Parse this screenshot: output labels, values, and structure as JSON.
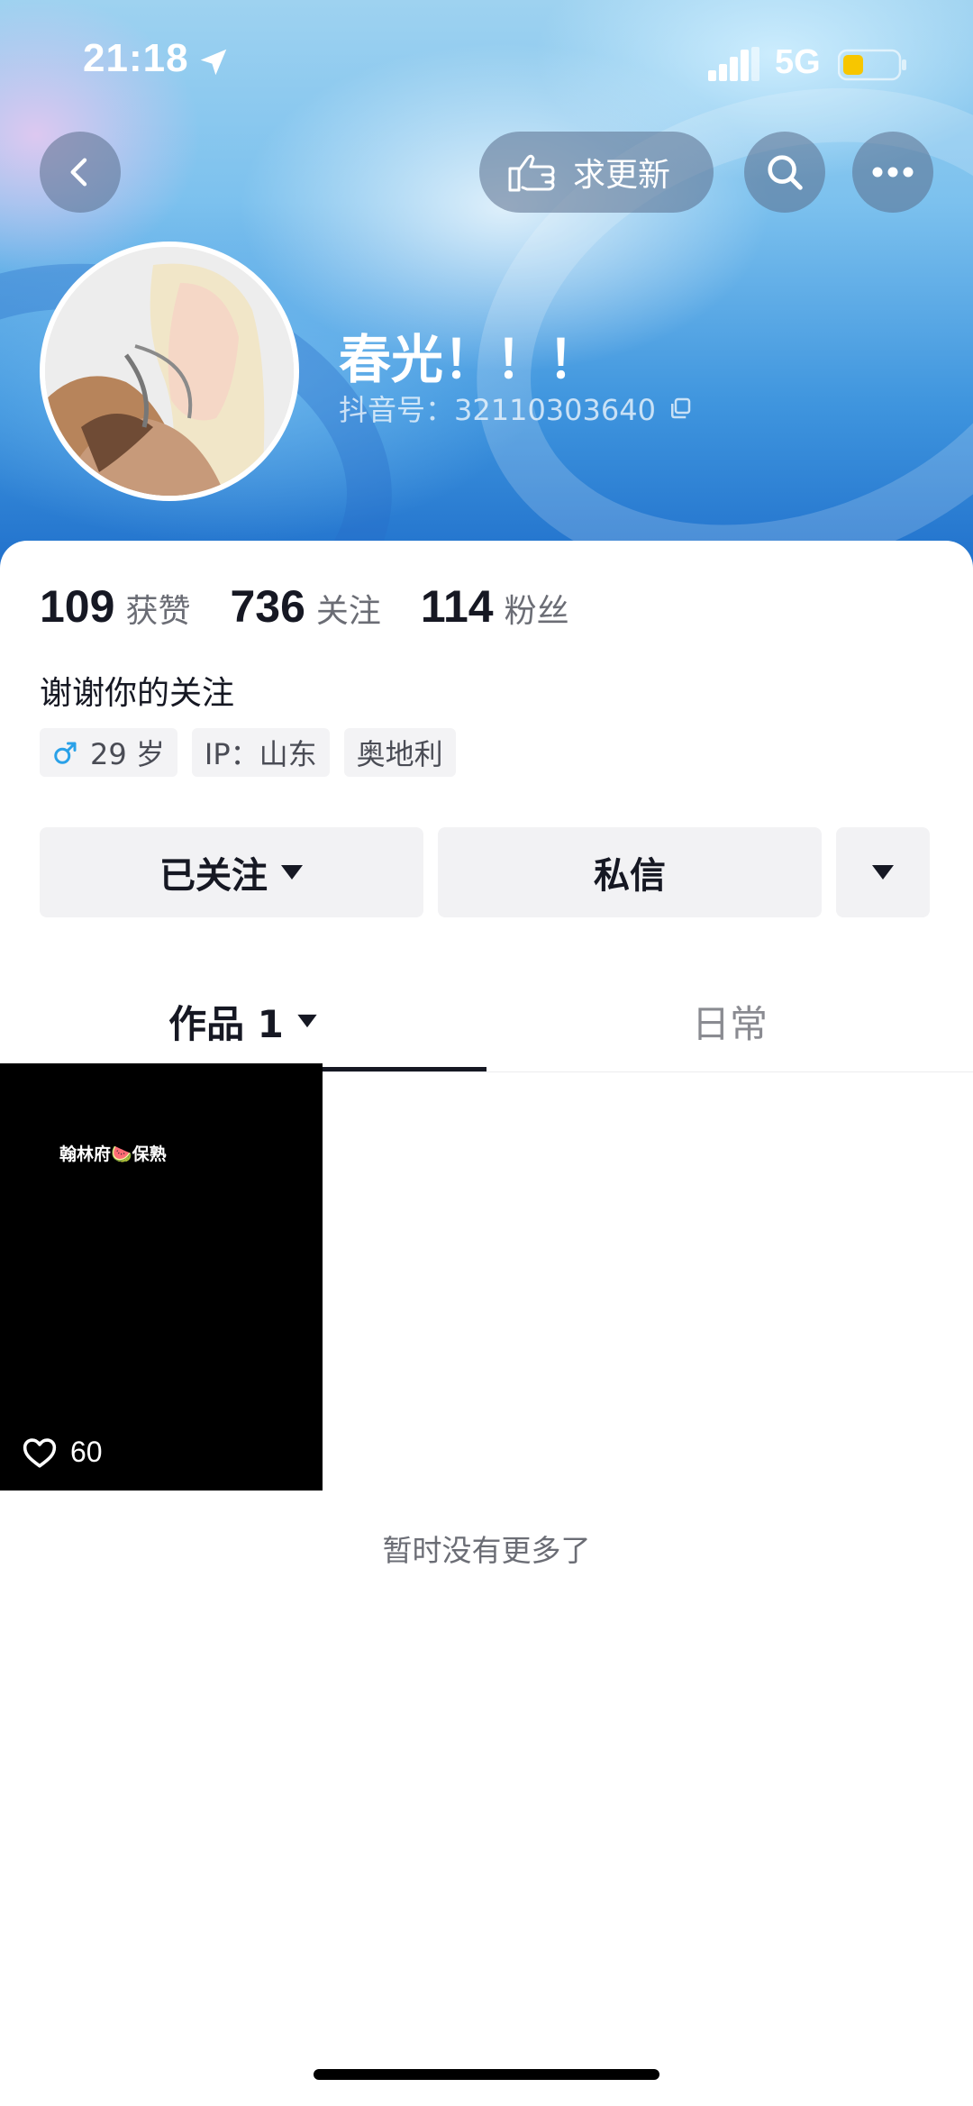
{
  "status_bar": {
    "time": "21:18",
    "network": "5G",
    "icons": [
      "location-arrow-icon",
      "signal-icon",
      "battery-icon"
    ],
    "battery_color": "#f7c600"
  },
  "toolbar": {
    "back_icon": "chevron-left-icon",
    "update_label": "求更新",
    "update_icon": "pointing-hand-icon",
    "search_icon": "search-icon",
    "more_icon": "more-dots-icon"
  },
  "profile": {
    "name": "春光！！！",
    "id_label": "抖音号：32110303640",
    "avatar": "avatar-photo"
  },
  "stats": [
    {
      "value": "109",
      "label": "获赞"
    },
    {
      "value": "736",
      "label": "关注"
    },
    {
      "value": "114",
      "label": "粉丝"
    }
  ],
  "bio": "谢谢你的关注",
  "tags": {
    "age": "29 岁",
    "ip": "IP：山东",
    "location": "奥地利"
  },
  "actions": {
    "follow_label": "已关注",
    "message_label": "私信"
  },
  "tabs": [
    {
      "label": "作品 1",
      "active": true
    },
    {
      "label": "日常",
      "active": false
    }
  ],
  "videos": [
    {
      "caption": "翰林府🍉保熟",
      "likes": "60"
    }
  ],
  "footer": {
    "no_more_text": "暂时没有更多了"
  },
  "colors": {
    "text_primary": "#161823",
    "text_secondary": "#6b6d75",
    "button_bg": "#f2f2f4",
    "male_accent": "#2aa1e8"
  }
}
